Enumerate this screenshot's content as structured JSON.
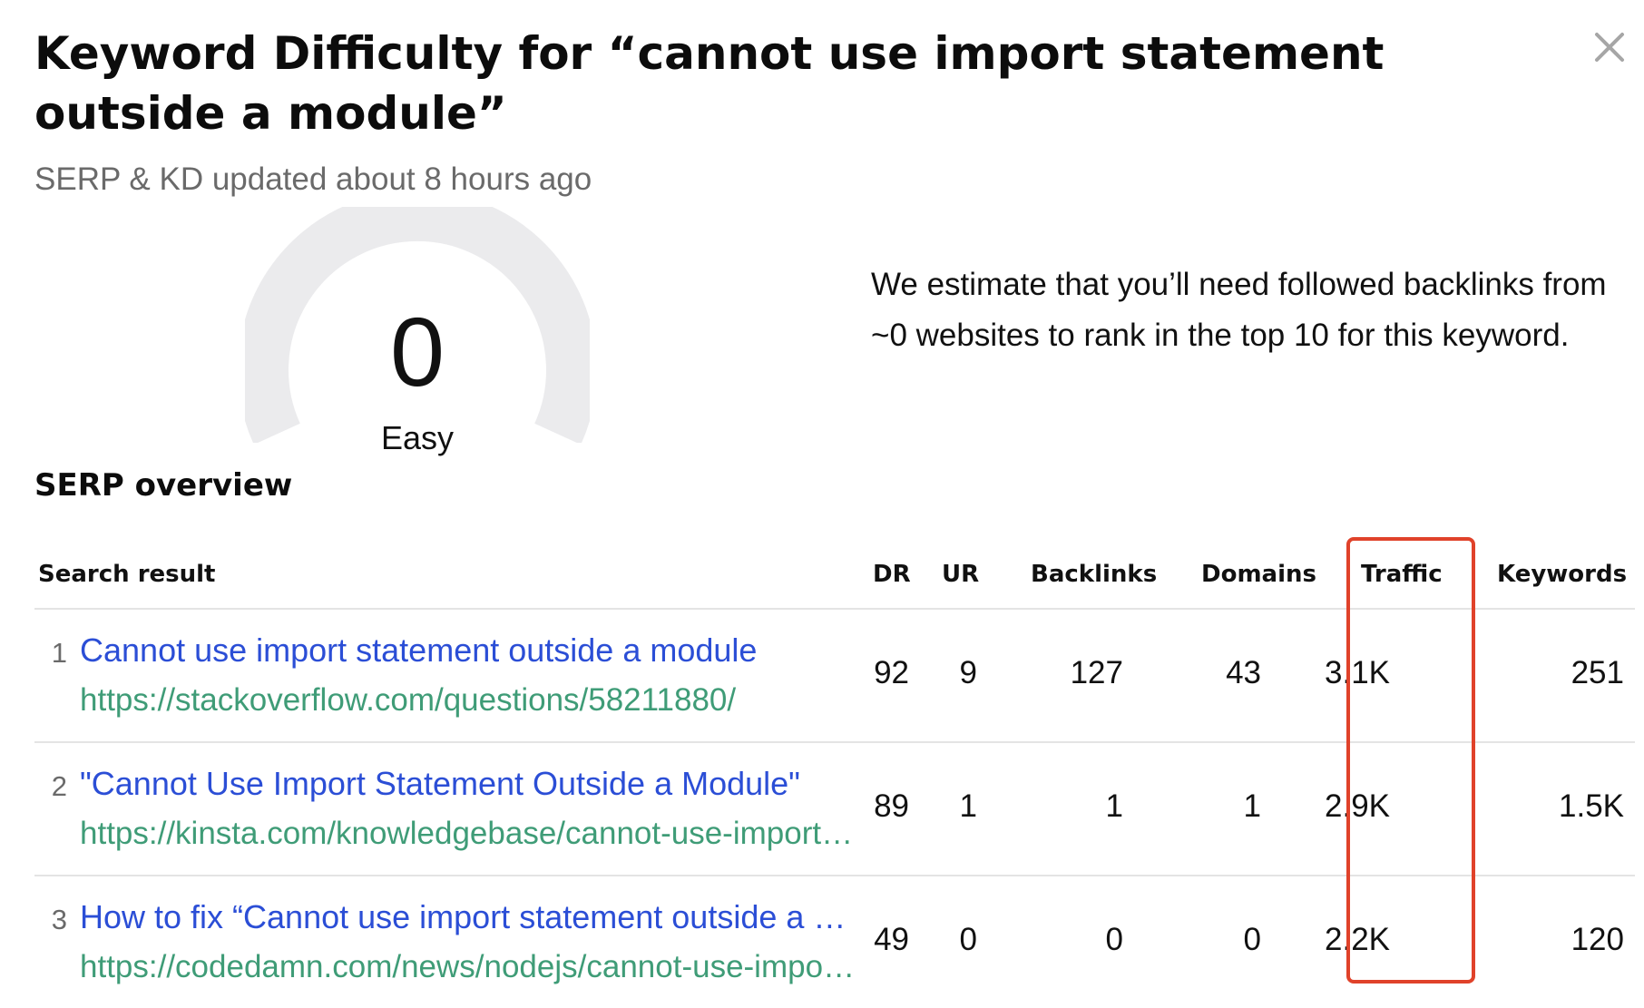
{
  "dialog": {
    "title": "Keyword Difficulty for “cannot use import statement outside a module”",
    "subtitle": "SERP & KD updated about 8 hours ago"
  },
  "kd": {
    "value": "0",
    "label": "Easy",
    "estimate": "We estimate that you’ll need followed backlinks from ~0 websites to rank in the top 10 for this keyword."
  },
  "serp": {
    "title": "SERP overview",
    "columns": {
      "result": "Search result",
      "dr": "DR",
      "ur": "UR",
      "backlinks": "Backlinks",
      "domains": "Domains",
      "traffic": "Traffic",
      "keywords": "Keywords"
    },
    "rows": [
      {
        "rank": "1",
        "title": "Cannot use import statement outside a module",
        "url": "https://stackoverflow.com/questions/58211880/",
        "dr": "92",
        "ur": "9",
        "backlinks": "127",
        "domains": "43",
        "traffic": "3.1K",
        "keywords": "251"
      },
      {
        "rank": "2",
        "title": "\"Cannot Use Import Statement Outside a Module\"",
        "url": "https://kinsta.com/knowledgebase/cannot-use-import-statement-outside-module/",
        "dr": "89",
        "ur": "1",
        "backlinks": "1",
        "domains": "1",
        "traffic": "2.9K",
        "keywords": "1.5K"
      },
      {
        "rank": "3",
        "title": "How to fix “Cannot use import statement outside a module”",
        "url": "https://codedamn.com/news/nodejs/cannot-use-import-statement-outside-a-module",
        "dr": "49",
        "ur": "0",
        "backlinks": "0",
        "domains": "0",
        "traffic": "2.2K",
        "keywords": "120"
      }
    ]
  },
  "colors": {
    "title_link": "#2b4ed6",
    "url_link": "#3f9c77",
    "gauge_track": "#ebebed",
    "highlight_box": "#e0422a"
  }
}
